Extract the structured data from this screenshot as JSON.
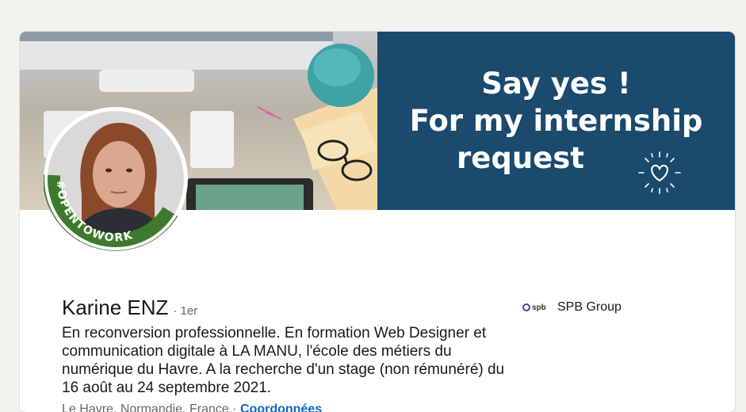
{
  "profile": {
    "name": "Karine ENZ",
    "degree": "· 1er",
    "headline": "En reconversion professionnelle. En formation Web Designer et communication digitale à LA MANU, l'école des métiers du numérique du Havre. A la recherche d'un stage (non rémunéré) du 16 août au 24 septembre 2021.",
    "location": "Le Havre, Normandie, France",
    "separator": " · ",
    "contact_link": "Coordonnées",
    "open_to_work_badge": "#OPENTOWORK"
  },
  "banner": {
    "line1": "Say yes !",
    "line2": "For my internship",
    "line3": "request",
    "background_color": "#1a4a6e",
    "heart_icon": "heart-icon"
  },
  "company": {
    "logo_text": "spb",
    "name": "SPB Group"
  },
  "colors": {
    "link": "#0a66c2",
    "open_to_work_green": "#3d7a2d",
    "page_background": "#f3f2ef"
  }
}
